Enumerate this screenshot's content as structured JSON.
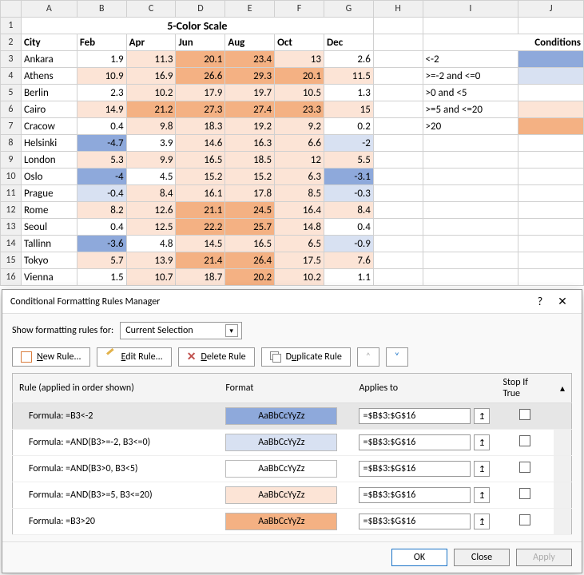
{
  "chart_data": {
    "type": "table",
    "title": "5-Color Scale",
    "columns": [
      "City",
      "Feb",
      "Apr",
      "Jun",
      "Aug",
      "Oct",
      "Dec"
    ],
    "rows": [
      [
        "Ankara",
        1.9,
        11.3,
        20.1,
        23.4,
        13,
        2.6
      ],
      [
        "Athens",
        10.9,
        16.9,
        26.6,
        29.3,
        20.1,
        11.5
      ],
      [
        "Berlin",
        2.3,
        10.2,
        17.9,
        19.7,
        10.5,
        1.3
      ],
      [
        "Cairo",
        14.9,
        21.2,
        27.3,
        27.4,
        23.3,
        15
      ],
      [
        "Cracow",
        0.4,
        9.8,
        18.3,
        19.2,
        9.2,
        0.2
      ],
      [
        "Helsinki",
        -4.7,
        3.9,
        14.6,
        16.3,
        6.6,
        -2
      ],
      [
        "London",
        5.3,
        9.9,
        16.5,
        18.5,
        12,
        5.5
      ],
      [
        "Oslo",
        -4,
        4.5,
        15.2,
        15.2,
        6.3,
        -3.1
      ],
      [
        "Prague",
        -0.4,
        8.4,
        16.1,
        17.8,
        8.5,
        -0.3
      ],
      [
        "Rome",
        8.2,
        12.6,
        21.1,
        24.5,
        16.4,
        8.4
      ],
      [
        "Seoul",
        0.4,
        12.5,
        22.2,
        25.7,
        14.8,
        0.4
      ],
      [
        "Tallinn",
        -3.6,
        4.8,
        14.5,
        16.5,
        6.5,
        -0.9
      ],
      [
        "Tokyo",
        5.7,
        13.9,
        21.4,
        26.4,
        17.5,
        7.6
      ],
      [
        "Vienna",
        1.5,
        10.7,
        18.7,
        20.2,
        10.2,
        1.1
      ]
    ],
    "conditions": [
      {
        "label": "<-2",
        "color": "#8ea9db"
      },
      {
        "label": ">=-2 and <=0",
        "color": "#d8e1f2"
      },
      {
        "label": ">0 and <5",
        "color": "#ffffff"
      },
      {
        "label": ">=5 and <=20",
        "color": "#fce4d6"
      },
      {
        "label": ">20",
        "color": "#f4b183"
      }
    ]
  },
  "sheet": {
    "col_letters": [
      "A",
      "B",
      "C",
      "D",
      "E",
      "F",
      "G",
      "H",
      "I",
      "J"
    ],
    "row_numbers": [
      "1",
      "2",
      "3",
      "4",
      "5",
      "6",
      "7",
      "8",
      "9",
      "10",
      "11",
      "12",
      "13",
      "14",
      "15",
      "16"
    ],
    "title": "5-Color Scale",
    "headers": {
      "city": "City",
      "feb": "Feb",
      "apr": "Apr",
      "jun": "Jun",
      "aug": "Aug",
      "oct": "Oct",
      "dec": "Dec",
      "conditions": "Conditions"
    },
    "rows": [
      {
        "city": "Ankara",
        "v": [
          "1.9",
          "11.3",
          "20.1",
          "23.4",
          "13",
          "2.6"
        ],
        "c": [
          "c3",
          "c4",
          "c5",
          "c5",
          "c4",
          "c3"
        ]
      },
      {
        "city": "Athens",
        "v": [
          "10.9",
          "16.9",
          "26.6",
          "29.3",
          "20.1",
          "11.5"
        ],
        "c": [
          "c4",
          "c4",
          "c5",
          "c5",
          "c5",
          "c4"
        ]
      },
      {
        "city": "Berlin",
        "v": [
          "2.3",
          "10.2",
          "17.9",
          "19.7",
          "10.5",
          "1.3"
        ],
        "c": [
          "c3",
          "c4",
          "c4",
          "c4",
          "c4",
          "c3"
        ]
      },
      {
        "city": "Cairo",
        "v": [
          "14.9",
          "21.2",
          "27.3",
          "27.4",
          "23.3",
          "15"
        ],
        "c": [
          "c4",
          "c5",
          "c5",
          "c5",
          "c5",
          "c4"
        ]
      },
      {
        "city": "Cracow",
        "v": [
          "0.4",
          "9.8",
          "18.3",
          "19.2",
          "9.2",
          "0.2"
        ],
        "c": [
          "c3",
          "c4",
          "c4",
          "c4",
          "c4",
          "c3"
        ]
      },
      {
        "city": "Helsinki",
        "v": [
          "-4.7",
          "3.9",
          "14.6",
          "16.3",
          "6.6",
          "-2"
        ],
        "c": [
          "c1",
          "c3",
          "c4",
          "c4",
          "c4",
          "c2"
        ]
      },
      {
        "city": "London",
        "v": [
          "5.3",
          "9.9",
          "16.5",
          "18.5",
          "12",
          "5.5"
        ],
        "c": [
          "c4",
          "c4",
          "c4",
          "c4",
          "c4",
          "c4"
        ]
      },
      {
        "city": "Oslo",
        "v": [
          "-4",
          "4.5",
          "15.2",
          "15.2",
          "6.3",
          "-3.1"
        ],
        "c": [
          "c1",
          "c3",
          "c4",
          "c4",
          "c4",
          "c1"
        ]
      },
      {
        "city": "Prague",
        "v": [
          "-0.4",
          "8.4",
          "16.1",
          "17.8",
          "8.5",
          "-0.3"
        ],
        "c": [
          "c2",
          "c4",
          "c4",
          "c4",
          "c4",
          "c2"
        ]
      },
      {
        "city": "Rome",
        "v": [
          "8.2",
          "12.6",
          "21.1",
          "24.5",
          "16.4",
          "8.4"
        ],
        "c": [
          "c4",
          "c4",
          "c5",
          "c5",
          "c4",
          "c4"
        ]
      },
      {
        "city": "Seoul",
        "v": [
          "0.4",
          "12.5",
          "22.2",
          "25.7",
          "14.8",
          "0.4"
        ],
        "c": [
          "c3",
          "c4",
          "c5",
          "c5",
          "c4",
          "c3"
        ]
      },
      {
        "city": "Tallinn",
        "v": [
          "-3.6",
          "4.8",
          "14.5",
          "16.5",
          "6.5",
          "-0.9"
        ],
        "c": [
          "c1",
          "c3",
          "c4",
          "c4",
          "c4",
          "c2"
        ]
      },
      {
        "city": "Tokyo",
        "v": [
          "5.7",
          "13.9",
          "21.4",
          "26.4",
          "17.5",
          "7.6"
        ],
        "c": [
          "c4",
          "c4",
          "c5",
          "c5",
          "c4",
          "c4"
        ]
      },
      {
        "city": "Vienna",
        "v": [
          "1.5",
          "10.7",
          "18.7",
          "20.2",
          "10.2",
          "1.1"
        ],
        "c": [
          "c3",
          "c4",
          "c4",
          "c5",
          "c4",
          "c3"
        ]
      }
    ],
    "conditions": [
      {
        "label": "<-2",
        "swatch": "cond-swatch-1"
      },
      {
        "label": ">=-2 and <=0",
        "swatch": "cond-swatch-2"
      },
      {
        "label": ">0 and <5",
        "swatch": "cond-swatch-3"
      },
      {
        "label": ">=5 and <=20",
        "swatch": "cond-swatch-4"
      },
      {
        "label": ">20",
        "swatch": "cond-swatch-5"
      }
    ]
  },
  "dialog": {
    "title": "Conditional Formatting Rules Manager",
    "show_rules_label": "Show formatting rules for:",
    "scope_value": "Current Selection",
    "toolbar": {
      "new": "New Rule...",
      "edit": "Edit Rule...",
      "delete": "Delete Rule",
      "duplicate": "Duplicate Rule"
    },
    "headers": {
      "rule": "Rule (applied in order shown)",
      "format": "Format",
      "applies": "Applies to",
      "stop": "Stop If True"
    },
    "format_preview_text": "AaBbCcYyZz",
    "rules": [
      {
        "formula": "Formula: =B3<-2",
        "swatch": "cond-swatch-1",
        "range": "=$B$3:$G$16",
        "selected": true
      },
      {
        "formula": "Formula: =AND(B3>=-2, B3<=0)",
        "swatch": "cond-swatch-2",
        "range": "=$B$3:$G$16",
        "selected": false
      },
      {
        "formula": "Formula: =AND(B3>0, B3<5)",
        "swatch": "cond-swatch-3",
        "range": "=$B$3:$G$16",
        "selected": false
      },
      {
        "formula": "Formula: =AND(B3>=5, B3<=20)",
        "swatch": "cond-swatch-4",
        "range": "=$B$3:$G$16",
        "selected": false
      },
      {
        "formula": "Formula: =B3>20",
        "swatch": "cond-swatch-5",
        "range": "=$B$3:$G$16",
        "selected": false
      }
    ],
    "footer": {
      "ok": "OK",
      "close": "Close",
      "apply": "Apply"
    }
  }
}
